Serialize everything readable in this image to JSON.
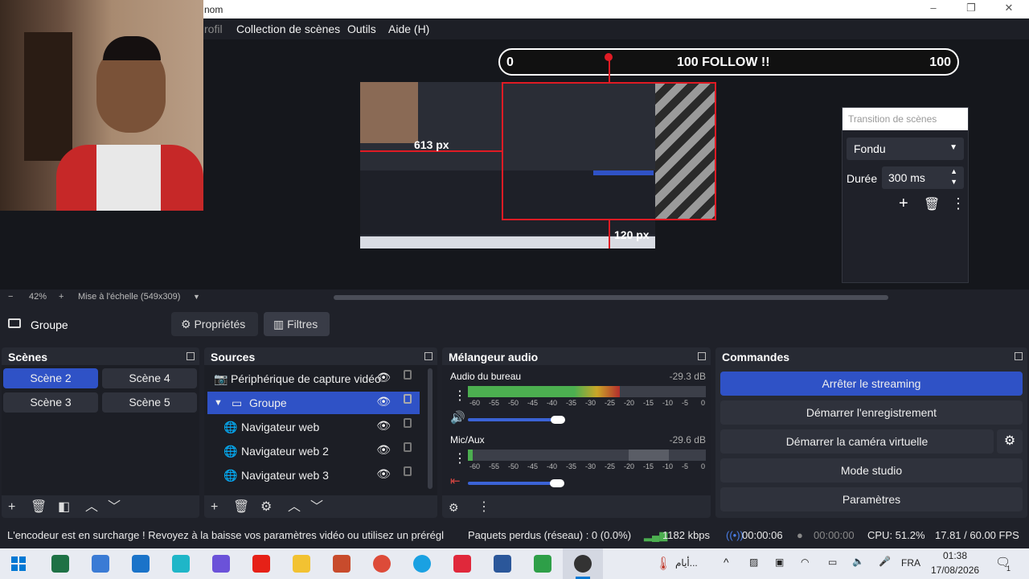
{
  "window": {
    "title": "nom",
    "minimize_glyph": "–",
    "maximize_glyph": "❐",
    "close_glyph": "✕"
  },
  "menu": {
    "items": [
      "rofil",
      "Collection de scènes",
      "Outils",
      "Aide (H)"
    ]
  },
  "overlay": {
    "follow_left": "0",
    "follow_center": "100 FOLLOW !!",
    "follow_right": "100",
    "dimension_left": "613 px",
    "dimension_bottom": "120 px"
  },
  "transition_panel": {
    "header": "Transition de scènes",
    "selected": "Fondu",
    "duration_label": "Durée",
    "duration_value": "300 ms"
  },
  "preview_toolbar": {
    "zoom_minus": "−",
    "zoom": "42%",
    "zoom_plus": "+",
    "scale_label": "Mise à l'échelle (549x309)"
  },
  "group_bar": {
    "label": "Groupe",
    "properties_button": "Propriétés",
    "filters_button": "Filtres"
  },
  "scenes": {
    "title": "Scènes",
    "items": [
      "Scène 2",
      "Scène 4",
      "Scène 3",
      "Scène 5"
    ],
    "active": "Scène 2"
  },
  "sources": {
    "title": "Sources",
    "items": [
      {
        "label": "Périphérique de capture vidéo",
        "icon": "camera-icon"
      },
      {
        "label": "Groupe",
        "icon": "folder-icon"
      },
      {
        "label": "Navigateur web",
        "icon": "globe-icon"
      },
      {
        "label": "Navigateur web 2",
        "icon": "globe-icon"
      },
      {
        "label": "Navigateur web 3",
        "icon": "globe-icon"
      }
    ]
  },
  "mixer": {
    "title": "Mélangeur audio",
    "channels": [
      {
        "name": "Audio du bureau",
        "db": "-29.3 dB",
        "level": 0.64
      },
      {
        "name": "Mic/Aux",
        "db": "-29.6 dB",
        "level": 0.63
      }
    ],
    "ticks": [
      "-60",
      "-55",
      "-50",
      "-45",
      "-40",
      "-35",
      "-30",
      "-25",
      "-20",
      "-15",
      "-10",
      "-5",
      "0"
    ]
  },
  "commands": {
    "title": "Commandes",
    "buttons": [
      "Arrêter le streaming",
      "Démarrer l'enregistrement",
      "Démarrer la caméra virtuelle",
      "Mode studio",
      "Paramètres"
    ]
  },
  "status": {
    "message": "L'encodeur est en surcharge ! Revoyez à la baisse vos paramètres vidéo ou utilisez un prérégl",
    "dropped": "Paquets perdus (réseau) : 0 (0.0%)",
    "bitrate": "1182 kbps",
    "stream_time": "00:00:06",
    "rec_time": "00:00:00",
    "cpu": "CPU: 51.2%",
    "fps": "17.81 / 60.00 FPS"
  },
  "taskbar": {
    "weather_text": "أيام...",
    "language": "FRA",
    "time": "01:38",
    "date": "17/08/2026",
    "notif_count": "1",
    "colors": {
      "excel": "#1e7145",
      "store": "#3a7bd5",
      "outlook": "#1a73c9",
      "app4": "#1fb6c8",
      "app5": "#6b52d9",
      "youtube": "#e62117",
      "explorer": "#f2c232",
      "powerpoint": "#c84b2c",
      "chrome": "#dd4b39",
      "edge": "#1aa1e2",
      "wps": "#e0283b",
      "word": "#2b579a",
      "az": "#2e9f48",
      "obs": "#333333"
    }
  }
}
